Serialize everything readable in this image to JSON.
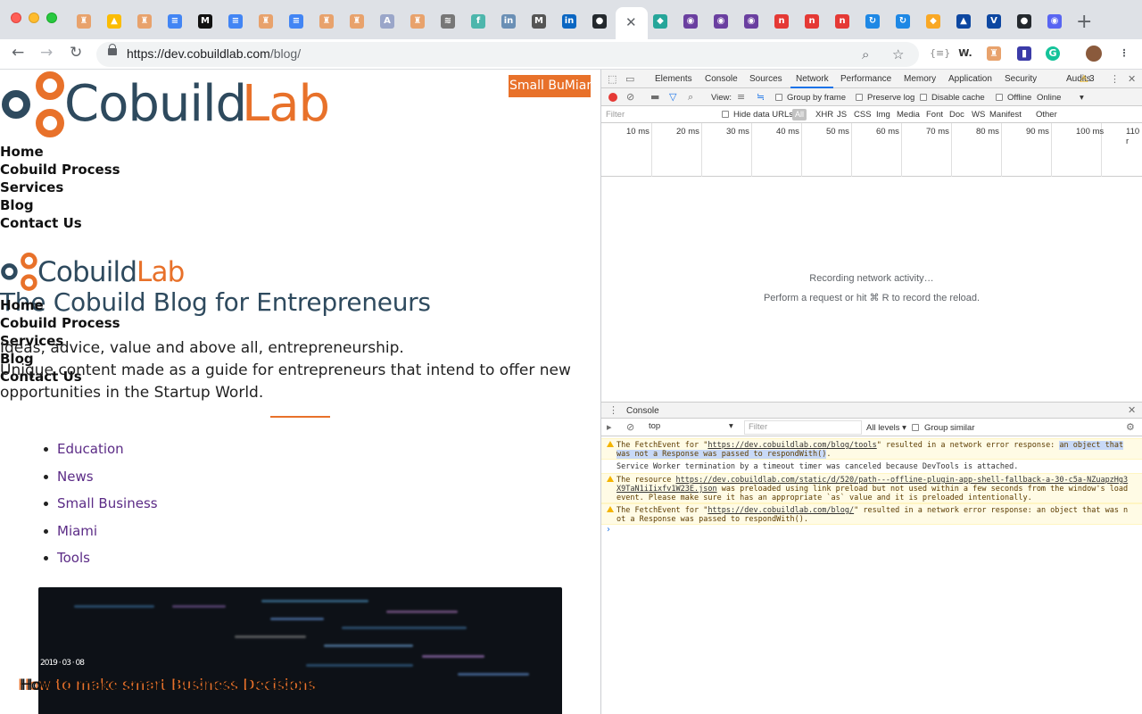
{
  "browser": {
    "url_host": "https://dev.cobuildlab.com",
    "url_path": "/blog/",
    "tab_icons": [
      {
        "name": "tab-favicon-1",
        "color": "#e8a26c",
        "glyph": "♜"
      },
      {
        "name": "tab-favicon-drive",
        "color": "#fbbc04",
        "glyph": "▲"
      },
      {
        "name": "tab-favicon-3",
        "color": "#e8a26c",
        "glyph": "♜"
      },
      {
        "name": "tab-favicon-docs",
        "color": "#4285f4",
        "glyph": "≡"
      },
      {
        "name": "tab-favicon-medium",
        "color": "#111111",
        "glyph": "M"
      },
      {
        "name": "tab-favicon-docs-2",
        "color": "#4285f4",
        "glyph": "≡"
      },
      {
        "name": "tab-favicon-7",
        "color": "#e8a26c",
        "glyph": "♜"
      },
      {
        "name": "tab-favicon-docs-3",
        "color": "#4285f4",
        "glyph": "≡"
      },
      {
        "name": "tab-favicon-9",
        "color": "#e8a26c",
        "glyph": "♜"
      },
      {
        "name": "tab-favicon-10",
        "color": "#e8a26c",
        "glyph": "♜"
      },
      {
        "name": "tab-favicon-11",
        "color": "#9aa6c9",
        "glyph": "A"
      },
      {
        "name": "tab-favicon-12",
        "color": "#e8a26c",
        "glyph": "♜"
      },
      {
        "name": "tab-favicon-13",
        "color": "#777777",
        "glyph": "≋"
      },
      {
        "name": "tab-favicon-14",
        "color": "#4db6ac",
        "glyph": "f"
      },
      {
        "name": "tab-favicon-linkedin",
        "color": "#6a8fb5",
        "glyph": "in"
      },
      {
        "name": "tab-favicon-medium-2",
        "color": "#555555",
        "glyph": "M"
      },
      {
        "name": "tab-favicon-linkedin-2",
        "color": "#0a66c2",
        "glyph": "in"
      },
      {
        "name": "tab-favicon-github",
        "color": "#24292e",
        "glyph": "●"
      }
    ],
    "tab_icons_after": [
      {
        "name": "tab-favicon-after-1",
        "color": "#26a69a",
        "glyph": "◆"
      },
      {
        "name": "tab-favicon-after-2",
        "color": "#6a3fa0",
        "glyph": "◉"
      },
      {
        "name": "tab-favicon-after-3",
        "color": "#6a3fa0",
        "glyph": "◉"
      },
      {
        "name": "tab-favicon-after-4",
        "color": "#6a3fa0",
        "glyph": "◉"
      },
      {
        "name": "tab-favicon-after-5",
        "color": "#e53935",
        "glyph": "n"
      },
      {
        "name": "tab-favicon-after-6",
        "color": "#e53935",
        "glyph": "n"
      },
      {
        "name": "tab-favicon-after-7",
        "color": "#e53935",
        "glyph": "n"
      },
      {
        "name": "tab-favicon-after-8",
        "color": "#1e88e5",
        "glyph": "↻"
      },
      {
        "name": "tab-favicon-after-9",
        "color": "#1e88e5",
        "glyph": "↻"
      },
      {
        "name": "tab-favicon-after-10",
        "color": "#f9a825",
        "glyph": "◆"
      },
      {
        "name": "tab-favicon-after-11",
        "color": "#0d47a1",
        "glyph": "▲"
      },
      {
        "name": "tab-favicon-after-12",
        "color": "#0d47a1",
        "glyph": "V"
      },
      {
        "name": "tab-favicon-after-13",
        "color": "#24292e",
        "glyph": "●"
      },
      {
        "name": "tab-favicon-after-14",
        "color": "#5865f2",
        "glyph": "◉"
      }
    ]
  },
  "site": {
    "logo_word1": "Cobuild",
    "logo_word2": "Lab",
    "cta_label": "Small BuMiami",
    "nav": [
      "Home",
      "Cobuild Process",
      "Services",
      "Blog",
      "Contact Us"
    ],
    "blog_title": "The Cobuild Blog for Entrepreneurs",
    "subtitle_1": "Ideas, advice, value and above all, entrepreneurship.",
    "subtitle_2": "Unique content made as a guide for entrepreneurs that intend to offer new",
    "subtitle_3": "opportunities in the Startup World.",
    "categories": [
      "Education",
      "News",
      "Small Business",
      "Miami",
      "Tools"
    ],
    "hero_overlap_small": "2019 · 03 · 08",
    "hero_overlap_title": "How to make smart Business Decisions",
    "colors": {
      "navy": "#2e4a5e",
      "orange": "#e8712a",
      "link": "#5b2b86"
    }
  },
  "devtools": {
    "tabs": [
      "Elements",
      "Console",
      "Sources",
      "Network",
      "Performance",
      "Memory",
      "Application",
      "Security",
      "Audits"
    ],
    "active_tab": "Network",
    "warn_count": "3",
    "view_label": "View:",
    "group_by_frame": "Group by frame",
    "preserve_log": "Preserve log",
    "disable_cache": "Disable cache",
    "offline": "Offline",
    "online": "Online",
    "filter_placeholder": "Filter",
    "hide_data_urls": "Hide data URLs",
    "type_filters": [
      "All",
      "XHR",
      "JS",
      "CSS",
      "Img",
      "Media",
      "Font",
      "Doc",
      "WS",
      "Manifest",
      "Other"
    ],
    "ticks": [
      "10 ms",
      "20 ms",
      "30 ms",
      "40 ms",
      "50 ms",
      "60 ms",
      "70 ms",
      "80 ms",
      "90 ms",
      "100 ms",
      "110 r"
    ],
    "recording": "Recording network activity…",
    "reload_hint": "Perform a request or hit ⌘ R to record the reload.",
    "drawer_tab": "Console",
    "context": "top",
    "console_filter": "Filter",
    "levels": "All levels ▾",
    "group_similar": "Group similar",
    "msg1_a": "The FetchEvent for \"",
    "msg1_link": "https://dev.cobuildlab.com/blog/tools",
    "msg1_b": "\" resulted in a network error response: ",
    "msg1_hl": "an object that was not a Response was passed to respondWith()",
    "msg1_c": ".",
    "msg2": "Service Worker termination by a timeout timer was canceled because DevTools is attached.",
    "msg3_a": "The resource ",
    "msg3_link": "https://dev.cobuildlab.com/static/d/520/path---offline-plugin-app-shell-fallback-a-30-c5a-NZuapzHg3X9TaN1iIixfv1W23E.json",
    "msg3_b": " was preloaded using link preload but not used within a few seconds from the window's load event. Please make sure it has an appropriate `as` value and it is preloaded intentionally.",
    "msg4_a": "The FetchEvent for \"",
    "msg4_link": "https://dev.cobuildlab.com/blog/",
    "msg4_b": "\" resulted in a network error response: an object that was not a Response was passed to respondWith()."
  }
}
